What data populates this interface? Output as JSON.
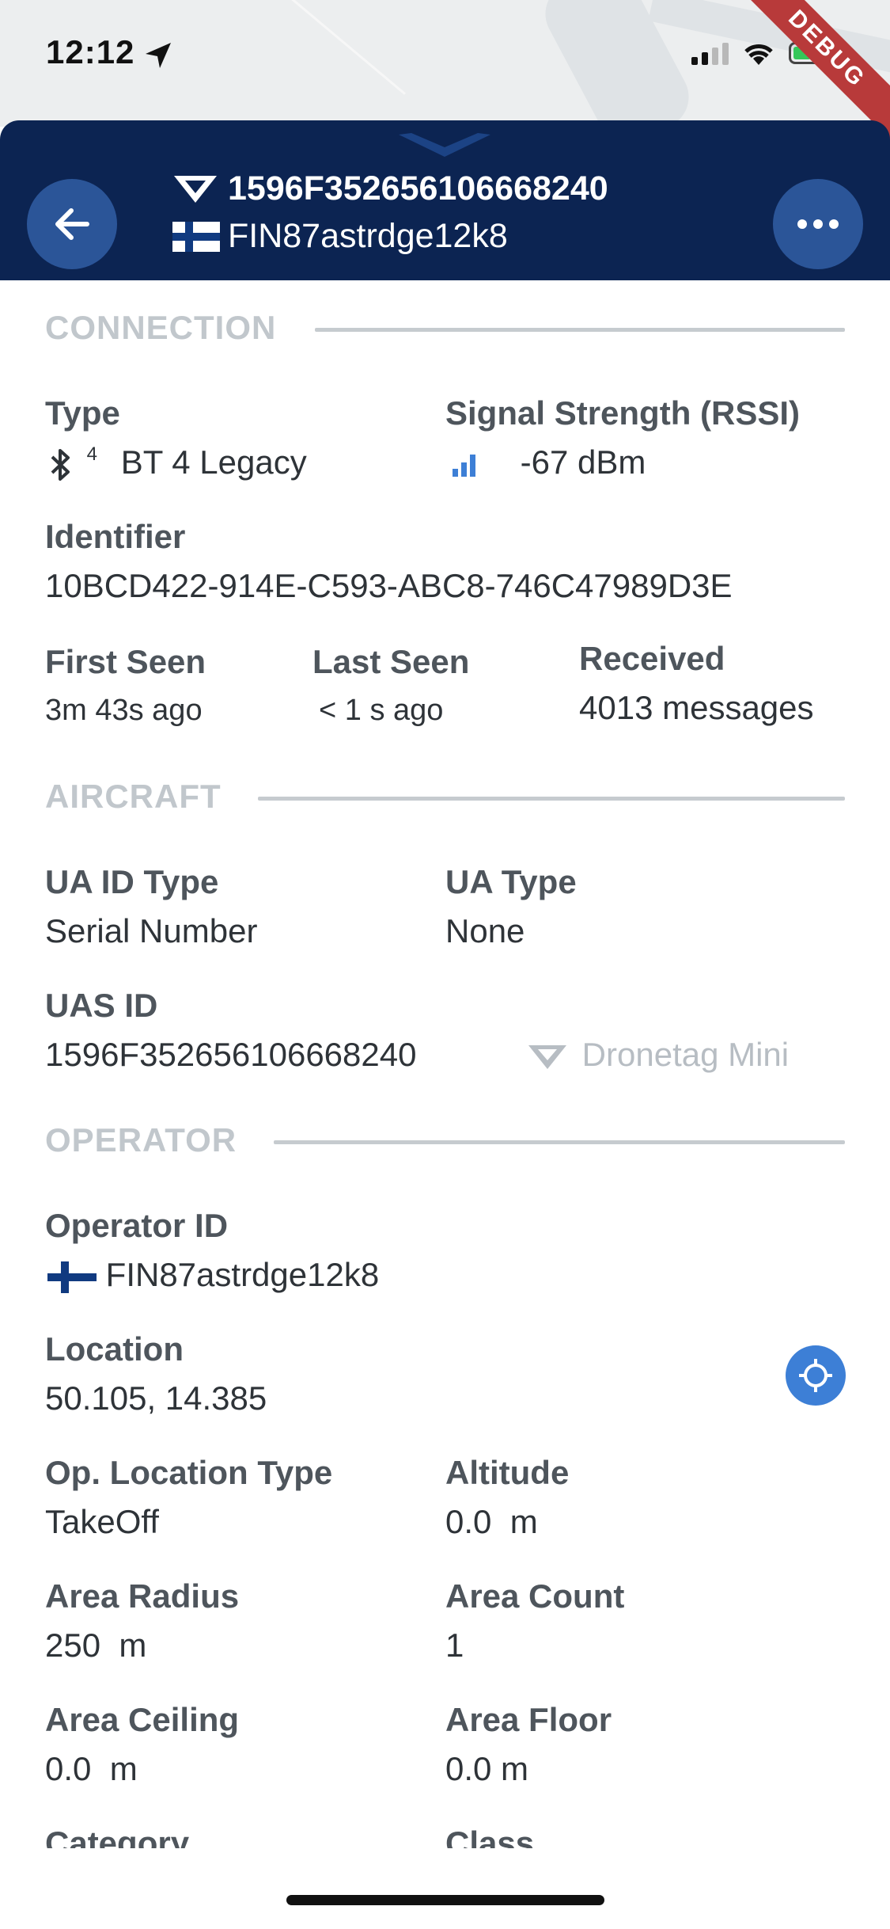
{
  "status_bar": {
    "time": "12:12",
    "debug_label": "DEBUG"
  },
  "header": {
    "title": "1596F352656106668240",
    "subtitle": "FIN87astrdge12k8",
    "flag": "finland-flag-icon",
    "brand_icon": "dronetag-logo-icon"
  },
  "sections": {
    "connection": {
      "title": "CONNECTION",
      "type_label": "Type",
      "type_value": "BT 4 Legacy",
      "type_icon": "bluetooth-icon",
      "type_superscript": "4",
      "rssi_label": "Signal Strength (RSSI)",
      "rssi_value": "-67 dBm",
      "identifier_label": "Identifier",
      "identifier_value": "10BCD422-914E-C593-ABC8-746C47989D3E",
      "first_seen_label": "First Seen",
      "first_seen_value": "3m 43s ago",
      "last_seen_label": "Last Seen",
      "last_seen_value": "< 1 s ago",
      "received_label": "Received",
      "received_value": "4013 messages"
    },
    "aircraft": {
      "title": "AIRCRAFT",
      "ua_id_type_label": "UA ID Type",
      "ua_id_type_value": "Serial Number",
      "ua_type_label": "UA Type",
      "ua_type_value": "None",
      "uas_id_label": "UAS ID",
      "uas_id_value": "1596F352656106668240",
      "model": "Dronetag Mini"
    },
    "operator": {
      "title": "OPERATOR",
      "operator_id_label": "Operator ID",
      "operator_id_value": "FIN87astrdge12k8",
      "location_label": "Location",
      "location_value": "50.105, 14.385",
      "op_location_type_label": "Op. Location Type",
      "op_location_type_value": "TakeOff",
      "altitude_label": "Altitude",
      "altitude_value": "0.0  m",
      "area_radius_label": "Area Radius",
      "area_radius_value": "250  m",
      "area_count_label": "Area Count",
      "area_count_value": "1",
      "area_ceiling_label": "Area Ceiling",
      "area_ceiling_value": "0.0  m",
      "area_floor_label": "Area Floor",
      "area_floor_value": "0.0 m",
      "category_label": "Category",
      "class_label": "Class"
    }
  },
  "colors": {
    "header_bg": "#0c2452",
    "button_bg": "#2b5598",
    "accent_blue": "#3d7fd6",
    "section_title": "#c1c7cc"
  }
}
